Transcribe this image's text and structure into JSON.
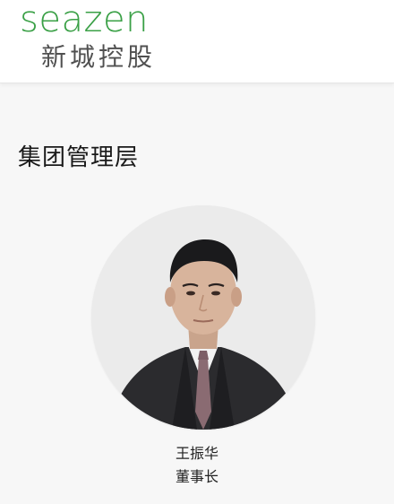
{
  "brand": {
    "name_en": "seazen",
    "name_cn": "新城控股",
    "color": "#3aa046"
  },
  "section": {
    "title": "集团管理层"
  },
  "person": {
    "name": "王振华",
    "title": "董事长",
    "photo_icon": "portrait-photo"
  }
}
